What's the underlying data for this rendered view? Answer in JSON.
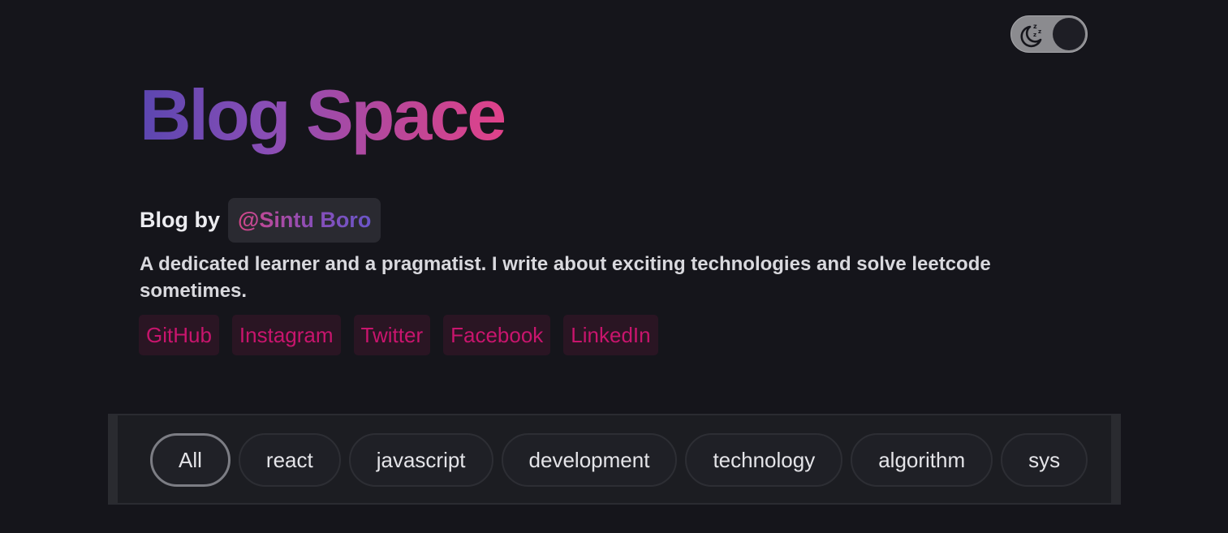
{
  "header": {
    "title": "Blog Space",
    "theme_toggle": {
      "icon": "moon-sleep-icon",
      "state": "dark"
    }
  },
  "author": {
    "byline_label": "Blog by",
    "handle": "@Sintu Boro",
    "bio": "A dedicated learner and a pragmatist. I write about exciting technologies and solve leetcode sometimes."
  },
  "socials": [
    {
      "label": "GitHub"
    },
    {
      "label": "Instagram"
    },
    {
      "label": "Twitter"
    },
    {
      "label": "Facebook"
    },
    {
      "label": "LinkedIn"
    }
  ],
  "tags": {
    "active": "All",
    "items": [
      {
        "label": "All"
      },
      {
        "label": "react"
      },
      {
        "label": "javascript"
      },
      {
        "label": "development"
      },
      {
        "label": "technology"
      },
      {
        "label": "algorithm"
      },
      {
        "label": "sys"
      }
    ]
  },
  "colors": {
    "background": "#15151b",
    "social_text": "#c8156d",
    "social_bg": "#2a1523",
    "title_gradient_start": "#5b46b0",
    "title_gradient_end": "#e0428a"
  }
}
